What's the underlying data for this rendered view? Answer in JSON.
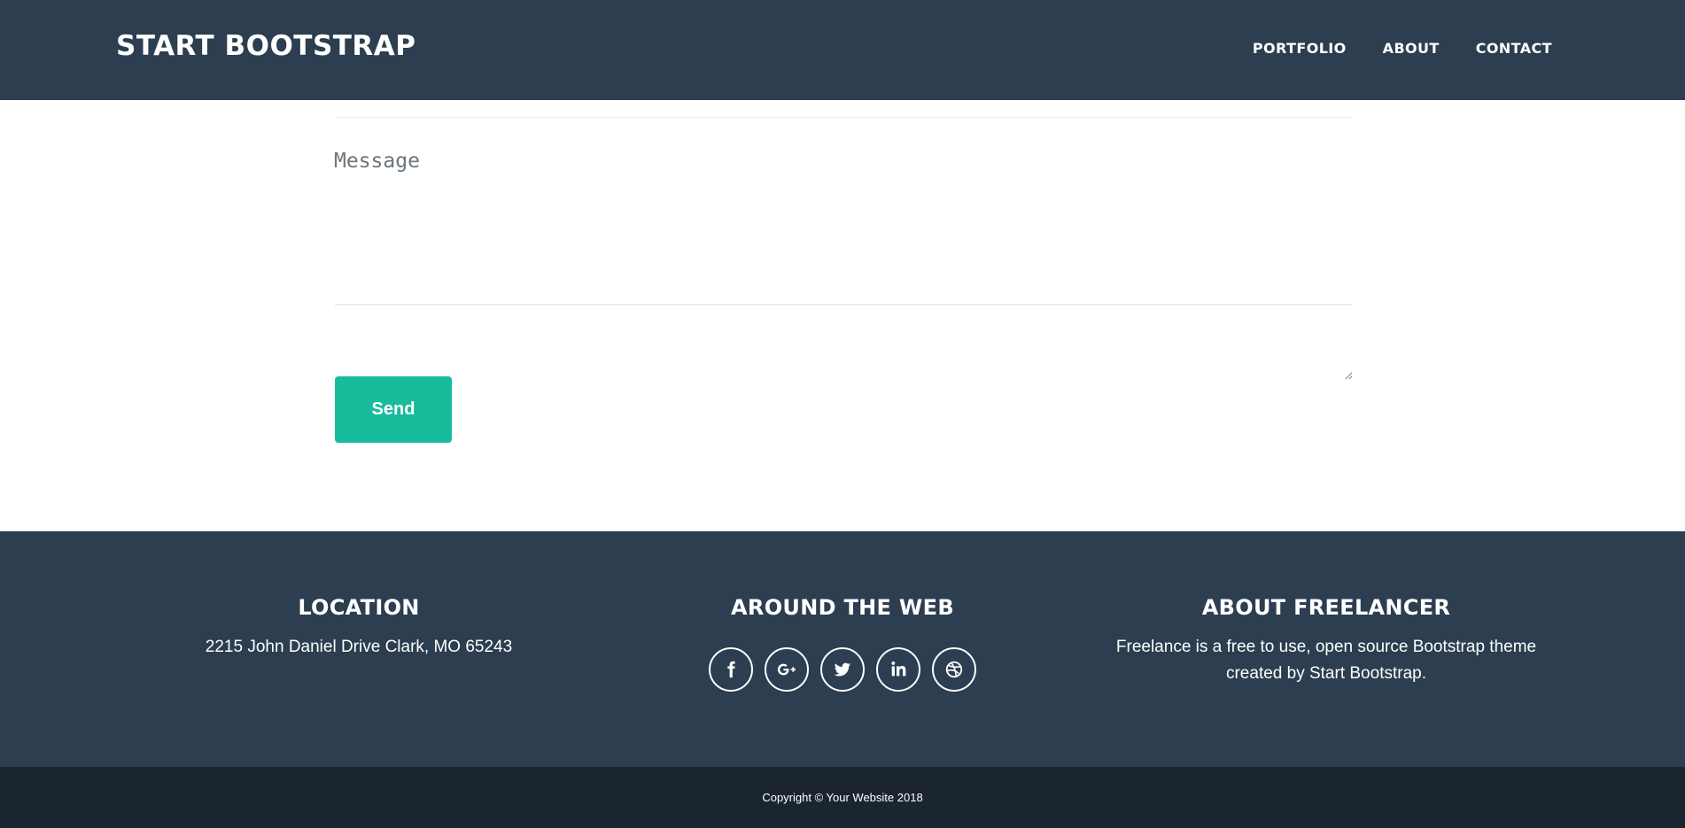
{
  "navbar": {
    "brand": "START BOOTSTRAP",
    "links": [
      "PORTFOLIO",
      "ABOUT",
      "CONTACT"
    ]
  },
  "contact_form": {
    "message_placeholder": "Message",
    "message_value": "",
    "send_label": "Send"
  },
  "footer": {
    "location": {
      "heading": "LOCATION",
      "text": "2215 John Daniel Drive Clark, MO 65243"
    },
    "around_web": {
      "heading": "AROUND THE WEB",
      "icons": [
        "facebook-icon",
        "google-plus-icon",
        "twitter-icon",
        "linkedin-icon",
        "dribbble-icon"
      ]
    },
    "about": {
      "heading": "ABOUT FREELANCER",
      "text": "Freelance is a free to use, open source Bootstrap theme created by Start Bootstrap."
    }
  },
  "copyright": "Copyright © Your Website 2018",
  "colors": {
    "primary_dark": "#2c3e50",
    "accent": "#18bc9c",
    "copyright_bg": "#1a252f"
  }
}
